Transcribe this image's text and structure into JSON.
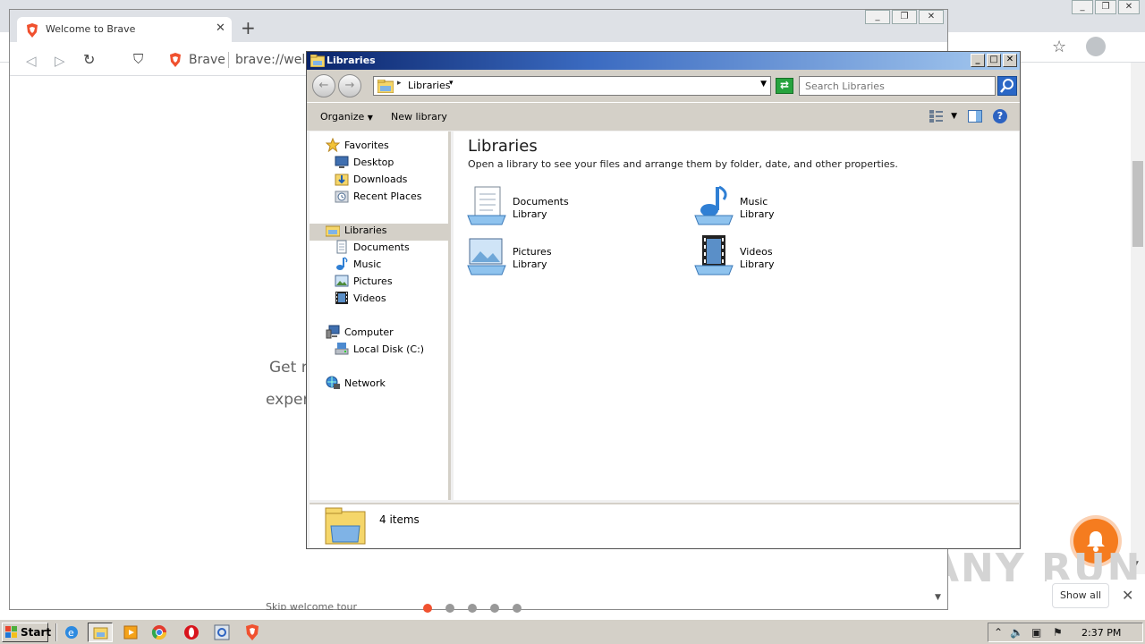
{
  "background_browser": {
    "show_all_label": "Show all",
    "watermark": "ANY RUN"
  },
  "brave": {
    "tab_title": "Welcome to Brave",
    "address_brand": "Brave",
    "address_url": "brave://welc",
    "content_line1": "Get r",
    "content_line2": "exper",
    "skip_tour": "Skip welcome tour",
    "active_dot": 1,
    "dot_count": 5,
    "colors": {
      "accent": "#f0512f",
      "notification": "#f57c1f"
    }
  },
  "explorer": {
    "window_title": "Libraries",
    "address_location": "Libraries",
    "search_placeholder": "Search Libraries",
    "toolbar": {
      "organize": "Organize",
      "new_library": "New library"
    },
    "nav": {
      "favorites": "Favorites",
      "favorites_items": [
        "Desktop",
        "Downloads",
        "Recent Places"
      ],
      "libraries": "Libraries",
      "libraries_items": [
        "Documents",
        "Music",
        "Pictures",
        "Videos"
      ],
      "computer": "Computer",
      "computer_items": [
        "Local Disk (C:)"
      ],
      "network": "Network"
    },
    "main": {
      "heading": "Libraries",
      "description": "Open a library to see your files and arrange them by folder, date, and other properties.",
      "items": [
        {
          "name": "Documents",
          "type": "Library",
          "icon": "documents-icon"
        },
        {
          "name": "Music",
          "type": "Library",
          "icon": "music-icon"
        },
        {
          "name": "Pictures",
          "type": "Library",
          "icon": "pictures-icon"
        },
        {
          "name": "Videos",
          "type": "Library",
          "icon": "videos-icon"
        }
      ]
    },
    "status": {
      "item_count": "4 items"
    }
  },
  "taskbar": {
    "start_label": "Start",
    "clock": "2:37 PM"
  }
}
